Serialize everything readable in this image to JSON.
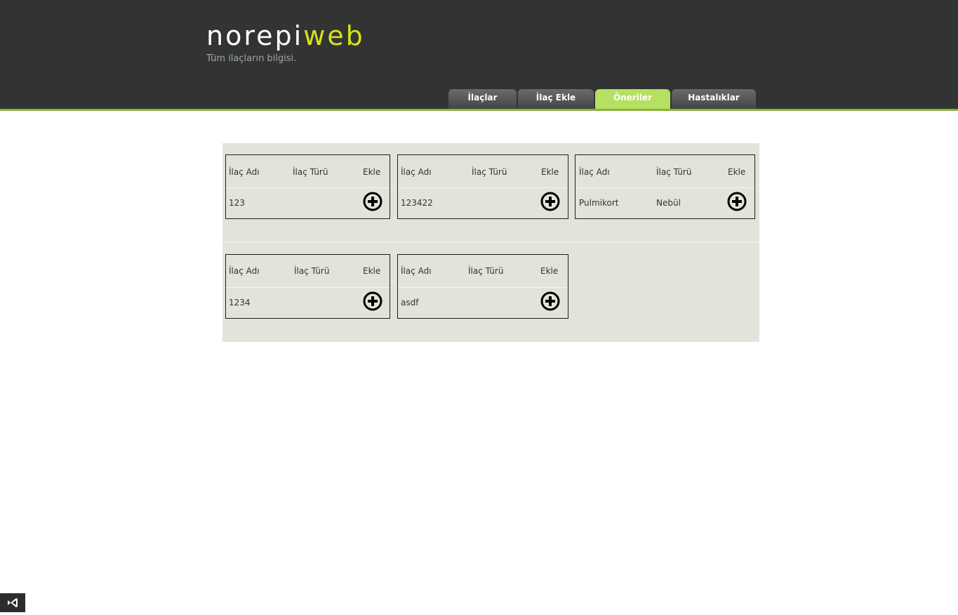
{
  "header": {
    "logo_part1": "norepi",
    "logo_part2": "web",
    "tagline": "Tüm ilaçların bilgisi."
  },
  "tabs": [
    {
      "label": "İlaçlar",
      "active": false
    },
    {
      "label": "İlaç Ekle",
      "active": false
    },
    {
      "label": "Öneriler",
      "active": true
    },
    {
      "label": "Hastalıklar",
      "active": false
    }
  ],
  "card_headers": {
    "name": "İlaç Adı",
    "type": "İlaç Türü",
    "add": "Ekle"
  },
  "cards": [
    {
      "name": "123",
      "type": ""
    },
    {
      "name": "123422",
      "type": ""
    },
    {
      "name": "Pulmikort",
      "type": "Nebül"
    },
    {
      "name": "1234",
      "type": ""
    },
    {
      "name": "asdf",
      "type": ""
    }
  ],
  "colors": {
    "header_bg": "#323434",
    "accent_line": "#8cb13d",
    "logo_accent": "#d7e11a",
    "active_tab": "#b5e061",
    "panel_bg": "#e3e3da"
  },
  "icons": {
    "add": "plus-circle-icon",
    "corner_badge": "visual-studio-icon"
  }
}
